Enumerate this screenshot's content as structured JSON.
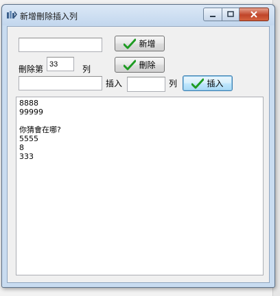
{
  "window": {
    "title": "新增刪除插入列"
  },
  "controls": {
    "add_input_value": "",
    "add_button_label": "新增",
    "delete_prefix_label": "刪除第",
    "delete_index_value": "33",
    "delete_suffix_label": "列",
    "delete_button_label": "刪除",
    "insert_text_value": "",
    "insert_label": "插入",
    "insert_row_value": "",
    "insert_row_suffix": "列",
    "insert_button_label": "插入"
  },
  "list": {
    "items": [
      "8888",
      "99999",
      "",
      "你猜會在哪?",
      "5555",
      "8",
      "333"
    ]
  },
  "colors": {
    "check_green": "#1e9b22",
    "close_red": "#c0452a"
  }
}
